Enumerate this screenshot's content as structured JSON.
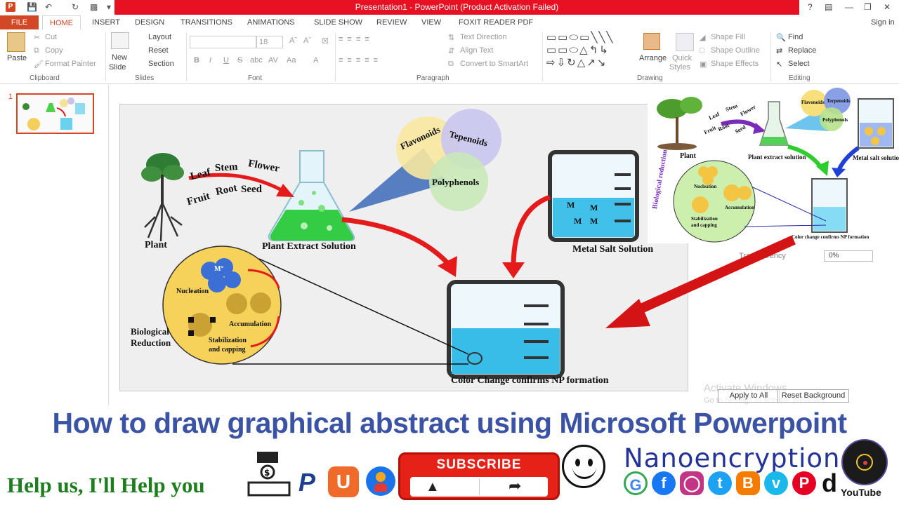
{
  "window": {
    "title": "Presentation1 - PowerPoint (Product Activation Failed)",
    "sign_in": "Sign in"
  },
  "tabs": [
    "FILE",
    "HOME",
    "INSERT",
    "DESIGN",
    "TRANSITIONS",
    "ANIMATIONS",
    "SLIDE SHOW",
    "REVIEW",
    "VIEW",
    "FOXIT READER PDF"
  ],
  "ribbon": {
    "clipboard": {
      "paste": "Paste",
      "cut": "Cut",
      "copy": "Copy",
      "format_painter": "Format Painter",
      "label": "Clipboard"
    },
    "slides": {
      "new_slide_1": "New",
      "new_slide_2": "Slide",
      "layout": "Layout",
      "reset": "Reset",
      "section": "Section",
      "label": "Slides"
    },
    "font": {
      "size": "18",
      "label": "Font",
      "bold": "B",
      "italic": "I",
      "underline": "U",
      "strike": "S",
      "shadow": "abc",
      "spacing": "AV",
      "case": "Aa",
      "color": "A"
    },
    "paragraph": {
      "text_direction": "Text Direction",
      "align_text": "Align Text",
      "smartart": "Convert to SmartArt",
      "label": "Paragraph"
    },
    "drawing": {
      "arrange": "Arrange",
      "quick_styles_1": "Quick",
      "quick_styles_2": "Styles",
      "shape_fill": "Shape Fill",
      "shape_outline": "Shape Outline",
      "shape_effects": "Shape Effects",
      "label": "Drawing"
    },
    "editing": {
      "find": "Find",
      "replace": "Replace",
      "select": "Select",
      "label": "Editing"
    }
  },
  "slide_panel": {
    "number": "1"
  },
  "slide": {
    "leaf": "Leaf",
    "stem": "Stem",
    "flower": "Flower",
    "fruit": "Fruit",
    "root": "Root",
    "seed": "Seed",
    "plant": "Plant",
    "extract": "Plant Extract Solution",
    "flavonoids": "Flavonoids",
    "terpenoids": "Tepenoids",
    "polyphenols": "Polyphenols",
    "metal_salt": "Metal Salt Solution",
    "m": "M",
    "nucleation": "Nucleation",
    "accumulation": "Accumulation",
    "stabilization": "Stabilization",
    "capping": "and capping",
    "bio_1": "Biological",
    "bio_2": "Reduction",
    "mo": "M°",
    "color_change": "Color Change confirms NP formation"
  },
  "inset": {
    "leaf": "Leaf",
    "stem": "Stem",
    "flower": "Flower",
    "fruit": "Fruit",
    "root": "Root",
    "seed": "Seed",
    "plant": "Plant",
    "extract": "Plant extract solution",
    "flavonoids": "Flavonoids",
    "terpenoids": "Terpenoids",
    "polyphenols": "Polyphenols",
    "metal_salt": "Metal salt solution",
    "bio": "Biological reduction",
    "nucleation": "Nucleation",
    "accumulation": "Accumulation",
    "stabilization": "Stabilization",
    "capping": "and capping",
    "color_change": "Color change confirms NP formation"
  },
  "format_pane": {
    "transparency": "Transparency",
    "percent": "0%",
    "apply_all": "Apply to All",
    "reset_bg": "Reset Background",
    "activate_1": "Activate Windows",
    "activate_2": "Go to Settings to activate Windows."
  },
  "banner": {
    "headline": "How to draw graphical abstract using Microsoft Powerpoint",
    "help": "Help us, I'll Help you",
    "subscribe": "SUBSCRIBE",
    "channel": "Nanoencryption",
    "youtube": "YouTube"
  },
  "colors": {
    "ppt_accent": "#d24726",
    "headline": "#3b53a4",
    "subscribe": "#e62117",
    "help_green": "#1e7d1e"
  }
}
